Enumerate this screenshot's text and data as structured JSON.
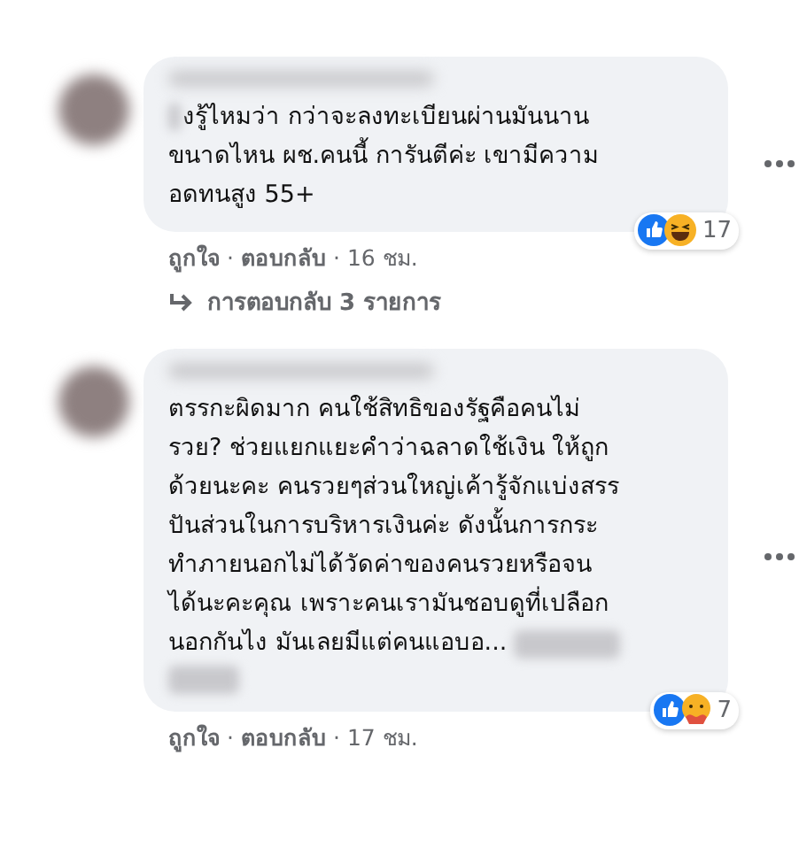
{
  "comments": [
    {
      "text": "งรู้ไหมว่า กว่าจะลงทะเบียนผ่านมันนาน\nขนาดไหน ผช.คนนี้ การันตีค่ะ เขามีความ\nอดทนสูง 55+",
      "reactions": [
        {
          "kind": "like"
        },
        {
          "kind": "haha"
        }
      ],
      "reaction_count": "17",
      "like": "ถูกใจ",
      "separator_1": "·",
      "reply": "ตอบกลับ",
      "separator_2": "·",
      "time": "16 ชม.",
      "replies_link": "การตอบกลับ 3 รายการ"
    },
    {
      "text": "ตรรกะผิดมาก คนใช้สิทธิของรัฐคือคนไม่\nรวย? ช่วยแยกแยะคำว่าฉลาดใช้เงิน ให้ถูก\nด้วยนะคะ คนรวยๆส่วนใหญ่เค้ารู้จักแบ่งสรร\nปันส่วนในการบริหารเงินค่ะ ดังนั้นการกระ\nทำภายนอกไม่ได้วัดค่าของคนรวยหรือจน\nได้นะคะคุณ เพราะคนเรามันชอบดูที่เปลือก\nนอกกันไง มันเลยมีแต่คนแอบอ...",
      "reactions": [
        {
          "kind": "like"
        },
        {
          "kind": "care"
        }
      ],
      "reaction_count": "7",
      "like": "ถูกใจ",
      "separator_1": "·",
      "reply": "ตอบกลับ",
      "separator_2": "·",
      "time": "17 ชม."
    }
  ]
}
